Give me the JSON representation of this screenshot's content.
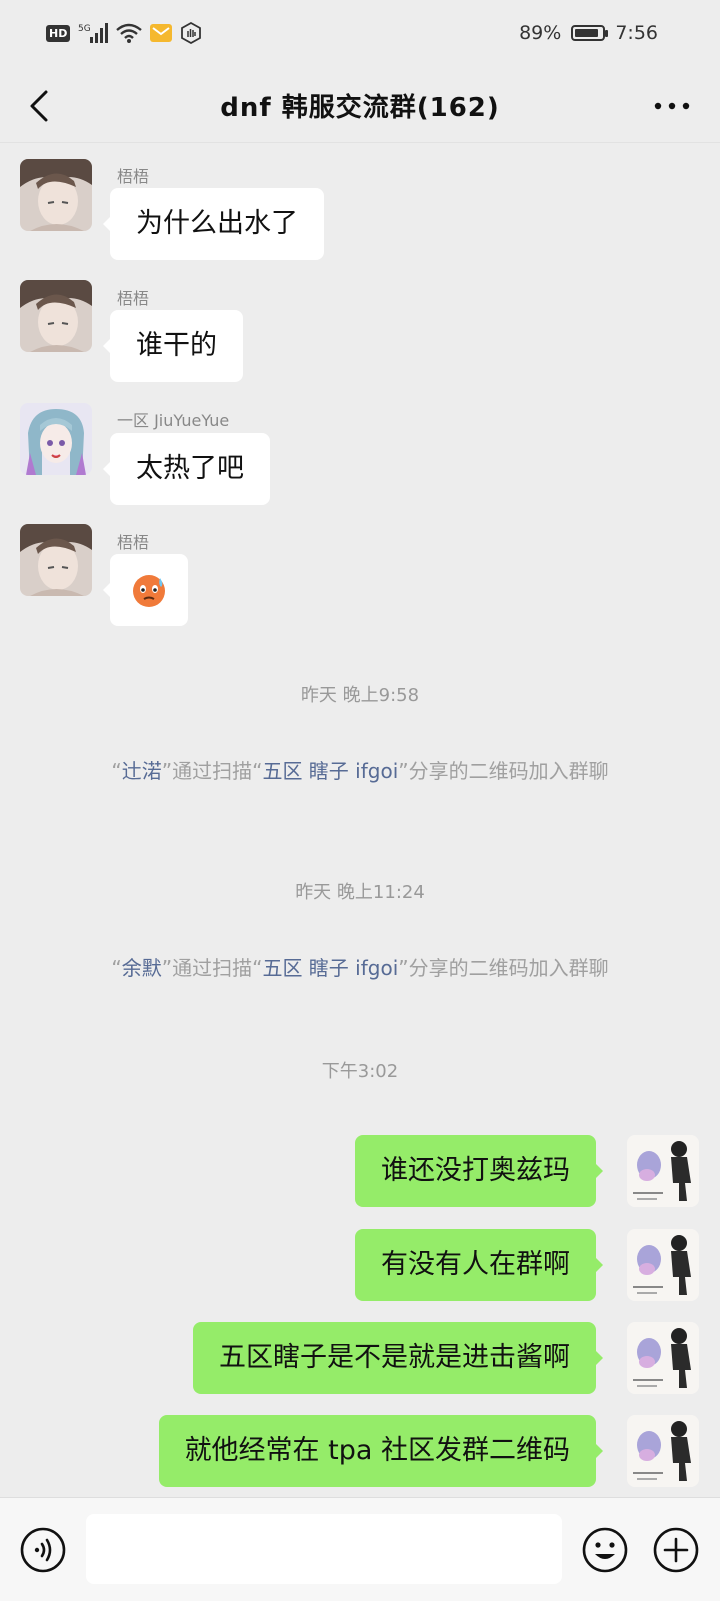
{
  "status_bar": {
    "hd_label": "HD",
    "network_label": "5G",
    "battery_text": "89%",
    "battery_level": 0.89,
    "time": "7:56"
  },
  "header": {
    "title": "dnf 韩服交流群(162)"
  },
  "messages": [
    {
      "sender": "梧梧",
      "text": "为什么出水了"
    },
    {
      "sender": "梧梧",
      "text": "谁干的"
    },
    {
      "sender": "一区 JiuYueYue",
      "text": "太热了吧"
    },
    {
      "sender": "梧梧",
      "text": "🥵",
      "emoji": "hot-face-emoji"
    }
  ],
  "timestamps": [
    "昨天 晚上9:58",
    "昨天 晚上11:24",
    "下午3:02"
  ],
  "system_messages": [
    {
      "q1": "“",
      "name1": "辻渃",
      "mid": "”通过扫描“",
      "name2": "五区 瞎子 ifgoi",
      "tail": "”分享的二维码加入群聊"
    },
    {
      "q1": "“",
      "name1": "余默",
      "mid": "”通过扫描“",
      "name2": "五区 瞎子 ifgoi",
      "tail": "”分享的二维码加入群聊"
    }
  ],
  "my_messages": [
    {
      "text": "谁还没打奥兹玛"
    },
    {
      "text": "有没有人在群啊"
    },
    {
      "text": "五区瞎子是不是就是进击酱啊"
    },
    {
      "text": "就他经常在 tpa 社区发群二维码"
    }
  ],
  "input": {
    "placeholder": "",
    "value": ""
  },
  "colors": {
    "background": "#ededed",
    "bubble_self": "#95ec69",
    "bubble_other": "#ffffff",
    "name_link": "#576b95"
  }
}
